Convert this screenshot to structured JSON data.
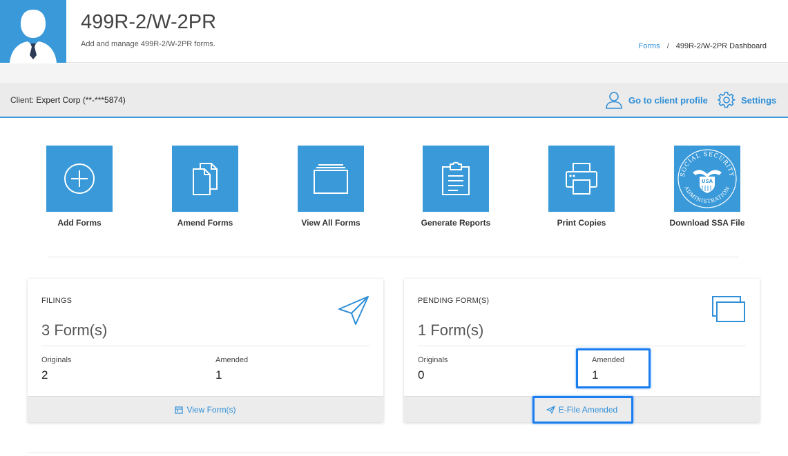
{
  "header": {
    "title": "499R-2/W-2PR",
    "subtitle": "Add and manage 499R-2/W-2PR forms.",
    "avatar_icon": "user-avatar-icon",
    "accent_color": "#3a9ad9",
    "breadcrumb": {
      "link_label": "Forms",
      "separator": "/",
      "current": "499R-2/W-2PR Dashboard"
    }
  },
  "client_bar": {
    "label": "Client:",
    "name": "Expert Corp (**-***5874)",
    "profile_label": "Go to client profile",
    "profile_icon": "user-outline-icon",
    "settings_label": "Settings",
    "settings_icon": "gear-icon"
  },
  "tiles": [
    {
      "label": "Add Forms",
      "icon": "plus-circle-icon"
    },
    {
      "label": "Amend Forms",
      "icon": "documents-icon"
    },
    {
      "label": "View All Forms",
      "icon": "stacked-window-icon"
    },
    {
      "label": "Generate Reports",
      "icon": "clipboard-icon"
    },
    {
      "label": "Print Copies",
      "icon": "printer-icon"
    },
    {
      "label": "Download SSA File",
      "icon": "ssa-seal-icon"
    }
  ],
  "ssa_seal": {
    "arc_top": "SOCIAL SECURITY",
    "arc_bottom": "ADMINISTRATION",
    "center": "USA"
  },
  "filings": {
    "title": "FILINGS",
    "count": "3 Form(s)",
    "originals_label": "Originals",
    "originals_value": "2",
    "amended_label": "Amended",
    "amended_value": "1",
    "action_label": "View Form(s)",
    "icon": "paper-plane-icon"
  },
  "pending": {
    "title": "PENDING FORM(S)",
    "count": "1 Form(s)",
    "originals_label": "Originals",
    "originals_value": "0",
    "amended_label": "Amended",
    "amended_value": "1",
    "action_label": "E-File Amended",
    "icon": "stacked-windows-icon"
  },
  "highlight_color": "#1a7ef0"
}
